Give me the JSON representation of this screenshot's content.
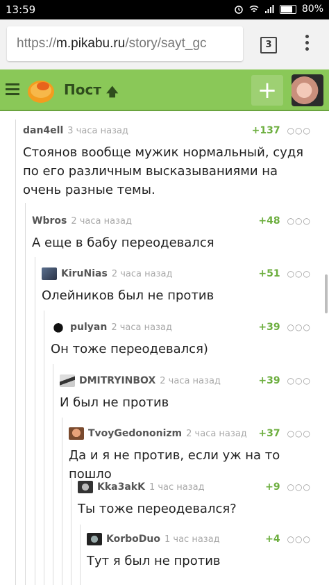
{
  "status": {
    "time": "13:59",
    "battery": "80%"
  },
  "browser": {
    "url_scheme": "https://",
    "url_host": "m.pikabu.ru",
    "url_path": "/story/sayt_gc",
    "tab_count": "3"
  },
  "appbar": {
    "title": "Пост",
    "plus": "+"
  },
  "comments": [
    {
      "author": "dan4ell",
      "time": "3 часа назад",
      "rating": "+137",
      "text": "Стоянов вообще мужик нормальный, судя по его различным высказываниями на очень разные темы."
    },
    {
      "author": "Wbros",
      "time": "2 часа назад",
      "rating": "+48",
      "text": "А еще в бабу переодевался"
    },
    {
      "author": "KiruNias",
      "time": "2 часа назад",
      "rating": "+51",
      "text": "Олейников был не против"
    },
    {
      "author": "pulyan",
      "time": "2 часа назад",
      "rating": "+39",
      "text": "Он тоже переодевался)"
    },
    {
      "author": "DMITRYINBOX",
      "time": "2 часа назад",
      "rating": "+39",
      "text": "И был не против"
    },
    {
      "author": "TvoyGedononizm",
      "time": "2 часа назад",
      "rating": "+37",
      "text": "Да и я не против, если уж на то пошло"
    },
    {
      "author": "Kka3akK",
      "time": "1 час назад",
      "rating": "+9",
      "text": "Ты тоже переодевался?"
    },
    {
      "author": "KorboDuo",
      "time": "1 час назад",
      "rating": "+4",
      "text": "Тут я был не против"
    }
  ]
}
